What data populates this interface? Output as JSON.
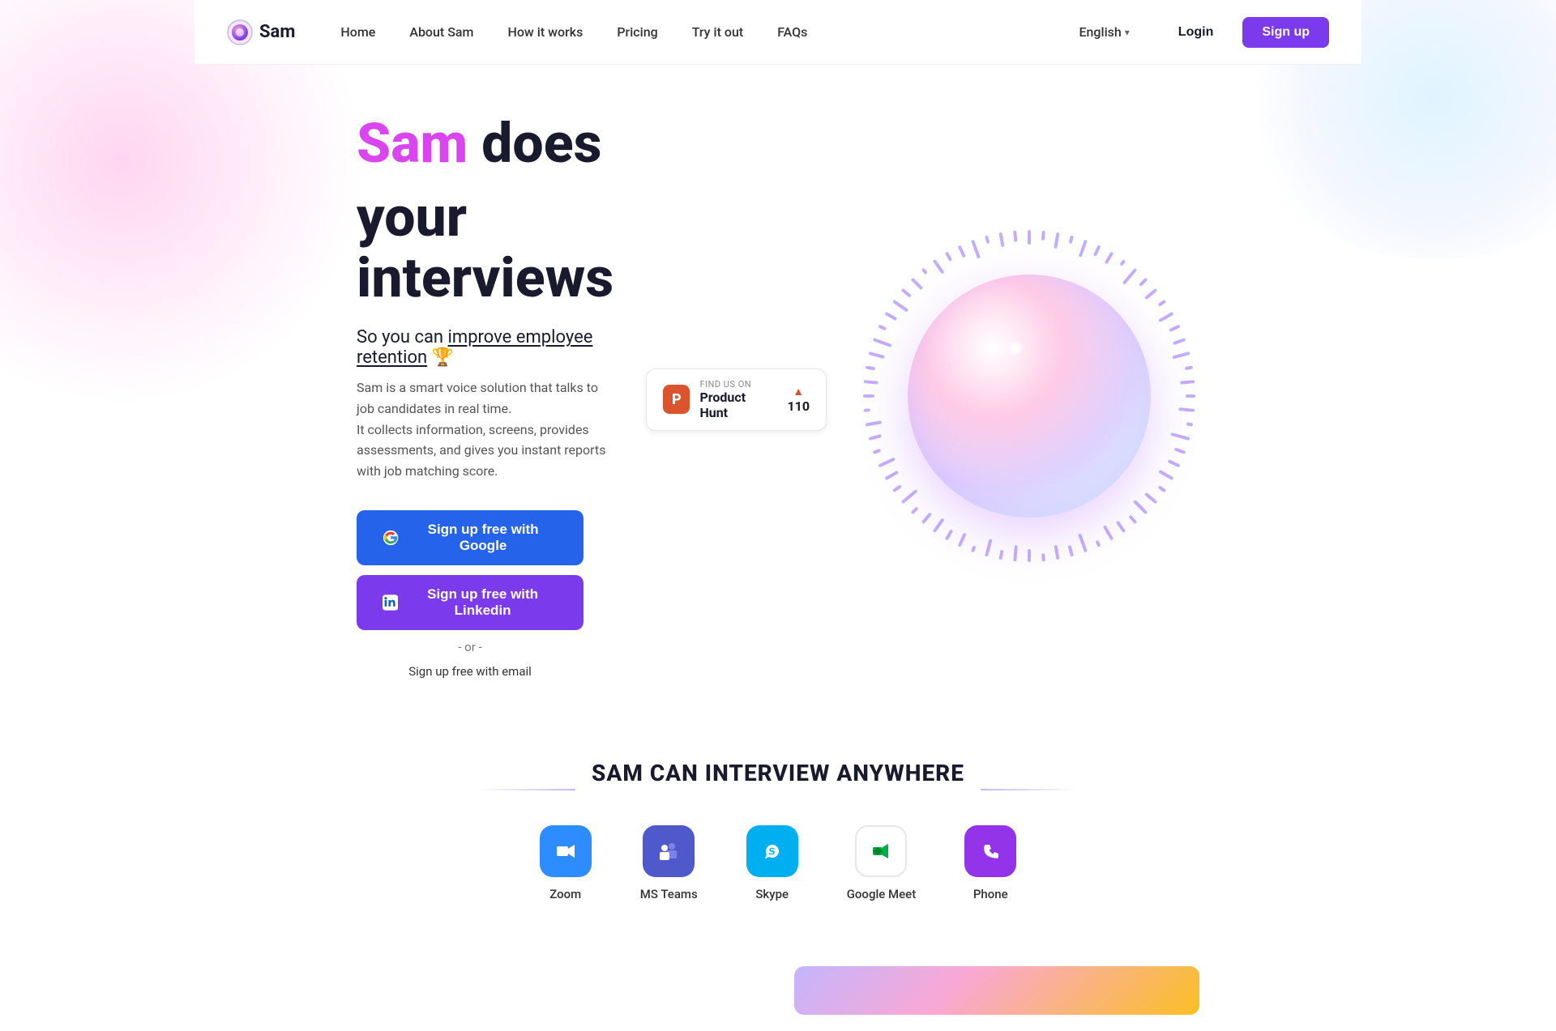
{
  "nav": {
    "logo_text": "Sam",
    "links": [
      {
        "label": "Home",
        "id": "home"
      },
      {
        "label": "About Sam",
        "id": "about"
      },
      {
        "label": "How it works",
        "id": "how"
      },
      {
        "label": "Pricing",
        "id": "pricing"
      },
      {
        "label": "Try it out",
        "id": "try"
      },
      {
        "label": "FAQs",
        "id": "faqs"
      }
    ],
    "language": "English",
    "login_label": "Login",
    "signup_label": "Sign up"
  },
  "hero": {
    "title_colored": "Sam",
    "title_rest": " does",
    "title_line2": "your interviews",
    "tagline_prefix": "So you can ",
    "tagline_emphasis": "improve employee retention",
    "tagline_emoji": "🏆",
    "desc_line1": "Sam is a smart voice solution that talks to job candidates in real time.",
    "desc_line2": "It collects information, screens, provides assessments, and gives you instant reports with job matching score.",
    "btn_google": "Sign up free with Google",
    "btn_linkedin": "Sign up free with Linkedin",
    "or_text": "- or -",
    "email_link": "Sign up free with email",
    "ph_find_us": "FIND US ON",
    "ph_name": "Product Hunt",
    "ph_votes": "110"
  },
  "anywhere": {
    "title": "SAM CAN INTERVIEW ANYWHERE",
    "platforms": [
      {
        "label": "Zoom",
        "id": "zoom"
      },
      {
        "label": "MS Teams",
        "id": "teams"
      },
      {
        "label": "Skype",
        "id": "skype"
      },
      {
        "label": "Google Meet",
        "id": "gmeet"
      },
      {
        "label": "Phone",
        "id": "phone"
      }
    ]
  }
}
